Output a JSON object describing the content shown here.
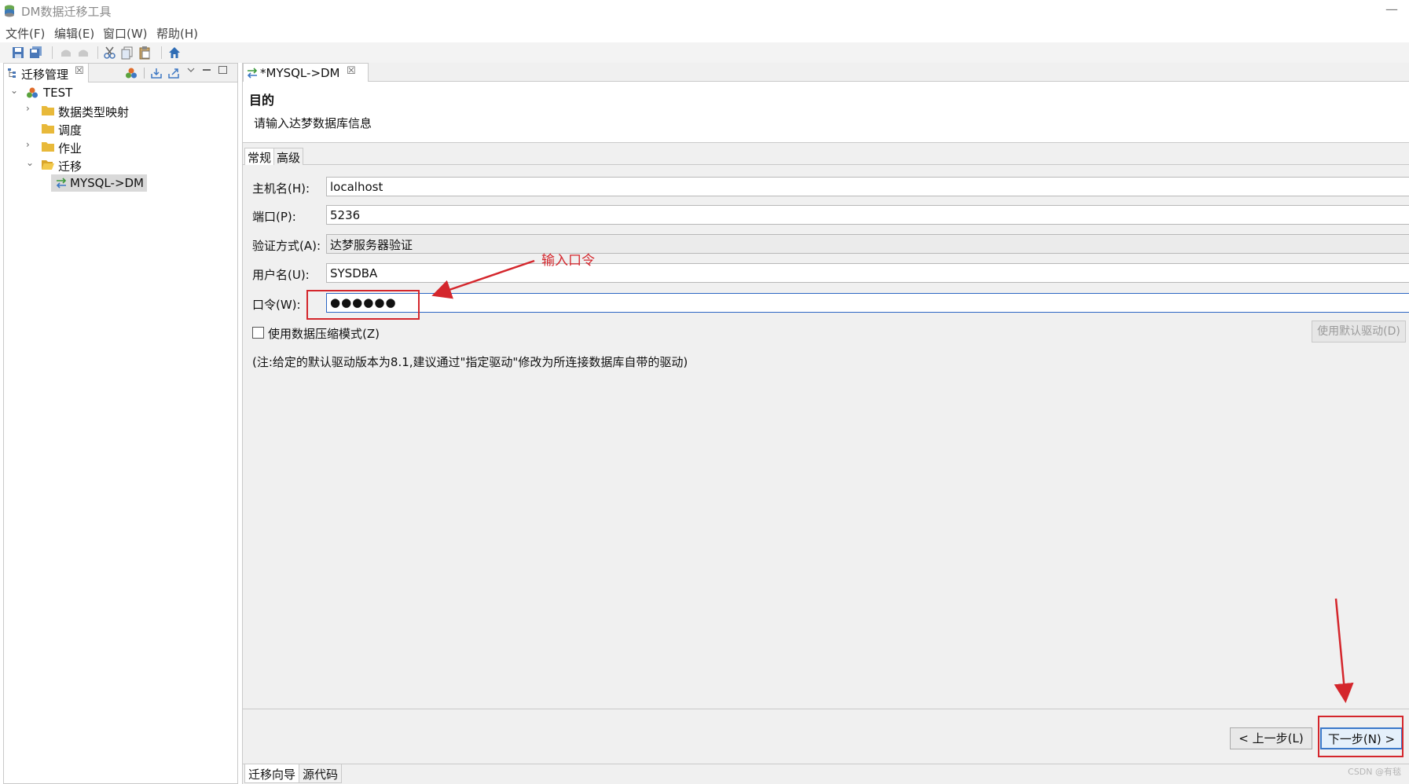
{
  "window": {
    "title": "DM数据迁移工具",
    "minimize": "—"
  },
  "menu": [
    {
      "label": "文件(F)"
    },
    {
      "label": "编辑(E)"
    },
    {
      "label": "窗口(W)"
    },
    {
      "label": "帮助(H)"
    }
  ],
  "left_panel": {
    "tab_label": "迁移管理",
    "close": "☒",
    "tree": {
      "root": "TEST",
      "items": [
        {
          "label": "数据类型映射"
        },
        {
          "label": "调度"
        },
        {
          "label": "作业"
        },
        {
          "label": "迁移"
        }
      ],
      "selected": "MYSQL->DM"
    }
  },
  "editor": {
    "tab_label": "*MYSQL->DM",
    "close": "☒",
    "header": {
      "title": "目的",
      "description": "请输入达梦数据库信息"
    },
    "subtabs": [
      {
        "label": "常规"
      },
      {
        "label": "高级"
      }
    ],
    "form": {
      "host": {
        "label": "主机名(H):",
        "value": "localhost"
      },
      "port": {
        "label": "端口(P):",
        "value": "5236"
      },
      "auth": {
        "label": "验证方式(A):",
        "value": "达梦服务器验证"
      },
      "user": {
        "label": "用户名(U):",
        "value": "SYSDBA"
      },
      "password": {
        "label": "口令(W):",
        "value": "●●●●●●"
      },
      "compress": {
        "label": "使用数据压缩模式(Z)",
        "checked": false
      },
      "default_driver_button": "使用默认驱动(D)",
      "note": "(注:给定的默认驱动版本为8.1,建议通过\"指定驱动\"修改为所连接数据库自带的驱动)"
    },
    "buttons": {
      "back": "< 上一步(L)",
      "next": "下一步(N) >"
    },
    "bottom_tabs": [
      {
        "label": "迁移向导"
      },
      {
        "label": "源代码"
      }
    ]
  },
  "annotation": {
    "text": "输入口令",
    "color": "#d4262c"
  },
  "watermark": "CSDN @有毯"
}
